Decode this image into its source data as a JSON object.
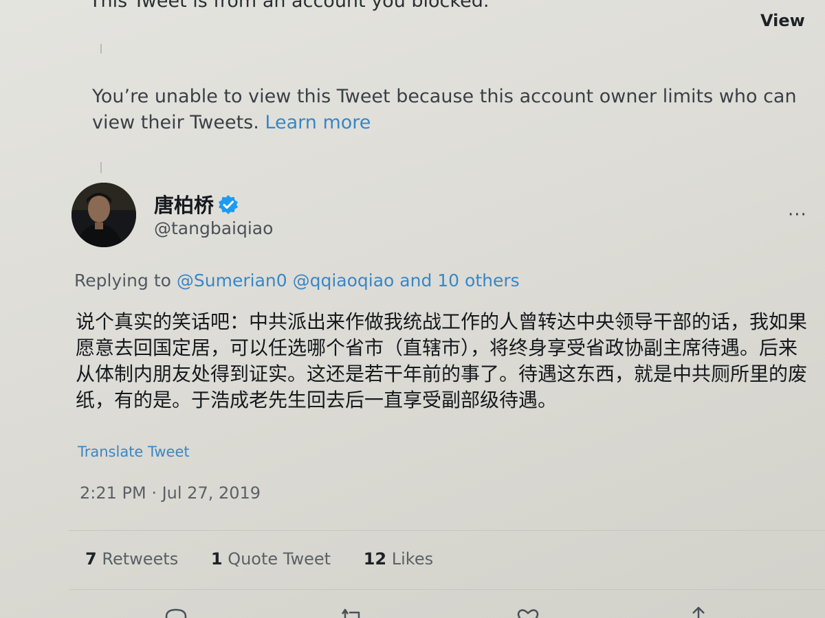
{
  "blocked": {
    "notice": "This Tweet is from an account you blocked.",
    "view_label": "View"
  },
  "limited": {
    "notice": "You’re unable to view this Tweet because this account owner limits who can view their Tweets.",
    "learn_more": "Learn more"
  },
  "tweet": {
    "display_name": "唐柏桥",
    "handle": "@tangbaiqiao",
    "more_icon": "more-horizontal-icon",
    "verified_icon": "verified-badge-icon",
    "replying_prefix": "Replying to",
    "replying_mentions": "@Sumerian0 @qqiaoqiao",
    "replying_suffix": "and 10 others",
    "text": "说个真实的笑话吧：中共派出来作做我统战工作的人曾转达中央领导干部的话，我如果愿意去回国定居，可以任选哪个省市（直辖市），将终身享受省政协副主席待遇。后来从体制内朋友处得到证实。这还是若干年前的事了。待遇这东西，就是中共厕所里的废纸，有的是。于浩成老先生回去后一直享受副部级待遇。",
    "translate_label": "Translate Tweet",
    "timestamp": "2:21 PM · Jul 27, 2019"
  },
  "stats": {
    "retweets_count": "7",
    "retweets_label": "Retweets",
    "quotes_count": "1",
    "quotes_label": "Quote Tweet",
    "likes_count": "12",
    "likes_label": "Likes"
  },
  "colors": {
    "link": "#3a86c4",
    "verified": "#1d9bf0",
    "background": "#dcdbd6"
  }
}
